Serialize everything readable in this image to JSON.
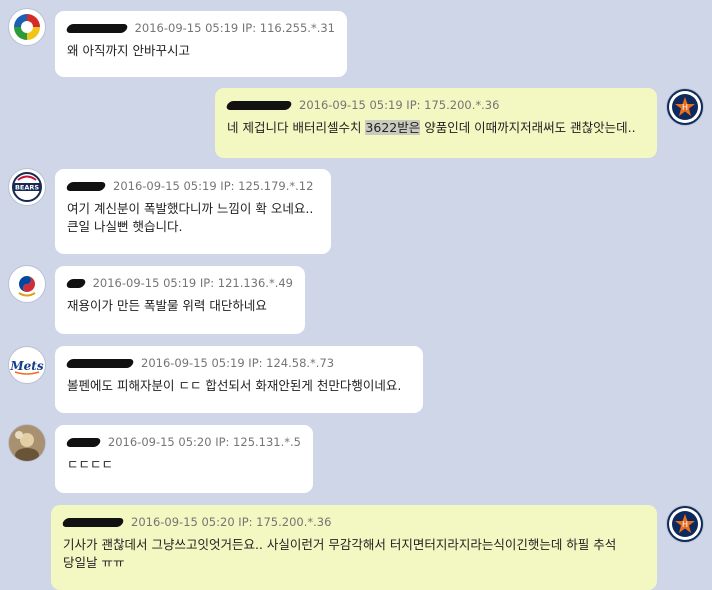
{
  "messages": [
    {
      "side": "left",
      "avatar": "wbc-logo-icon",
      "date": "2016-09-15 05:19",
      "ip": "IP: 116.255.*.31",
      "text": "왜 아직까지 안바꾸시고"
    },
    {
      "side": "right",
      "avatar": "astros-logo-icon",
      "date": "2016-09-15 05:19",
      "ip": "IP: 175.200.*.36",
      "text_pre": "네 제겁니다 배터리셀수치 ",
      "text_hl": "3622받은",
      "text_post": " 양품인데 이때까지저래써도 괜찮앗는데.."
    },
    {
      "side": "left",
      "avatar": "bears-logo-icon",
      "date": "2016-09-15 05:19",
      "ip": "IP: 125.179.*.12",
      "text": "여기 계신분이 폭발했다니까 느낌이 확 오네요..\n큰일 나실뻔 햇습니다."
    },
    {
      "side": "left",
      "avatar": "korea-emblem-icon",
      "date": "2016-09-15 05:19",
      "ip": "IP: 121.136.*.49",
      "text": "재용이가 만든 폭발물 위력 대단하네요"
    },
    {
      "side": "left",
      "avatar": "mets-logo-icon",
      "date": "2016-09-15 05:19",
      "ip": "IP: 124.58.*.73",
      "text": "볼펜에도 피해자분이 ㄷㄷ 합선되서 화재안된게 천만다행이네요."
    },
    {
      "side": "left",
      "avatar": "user-photo-icon",
      "date": "2016-09-15 05:20",
      "ip": "IP: 125.131.*.5",
      "text": "ㄷㄷㄷㄷ"
    },
    {
      "side": "right",
      "avatar": "astros-logo-icon",
      "date": "2016-09-15 05:20",
      "ip": "IP: 175.200.*.36",
      "text": "기사가 괜찮데서 그냥쓰고잇엇거든요.. 사실이런거 무감각해서 터지면터지라지라는식이긴햇는데 하필 추석\n당일날 ㅠㅠ"
    }
  ],
  "colors": {
    "background": "#cfd6e8",
    "left_bubble": "#ffffff",
    "right_bubble": "#f3f7c1"
  },
  "logos": {
    "mets": "Mets",
    "bears": "BEARS",
    "astros": "H"
  }
}
